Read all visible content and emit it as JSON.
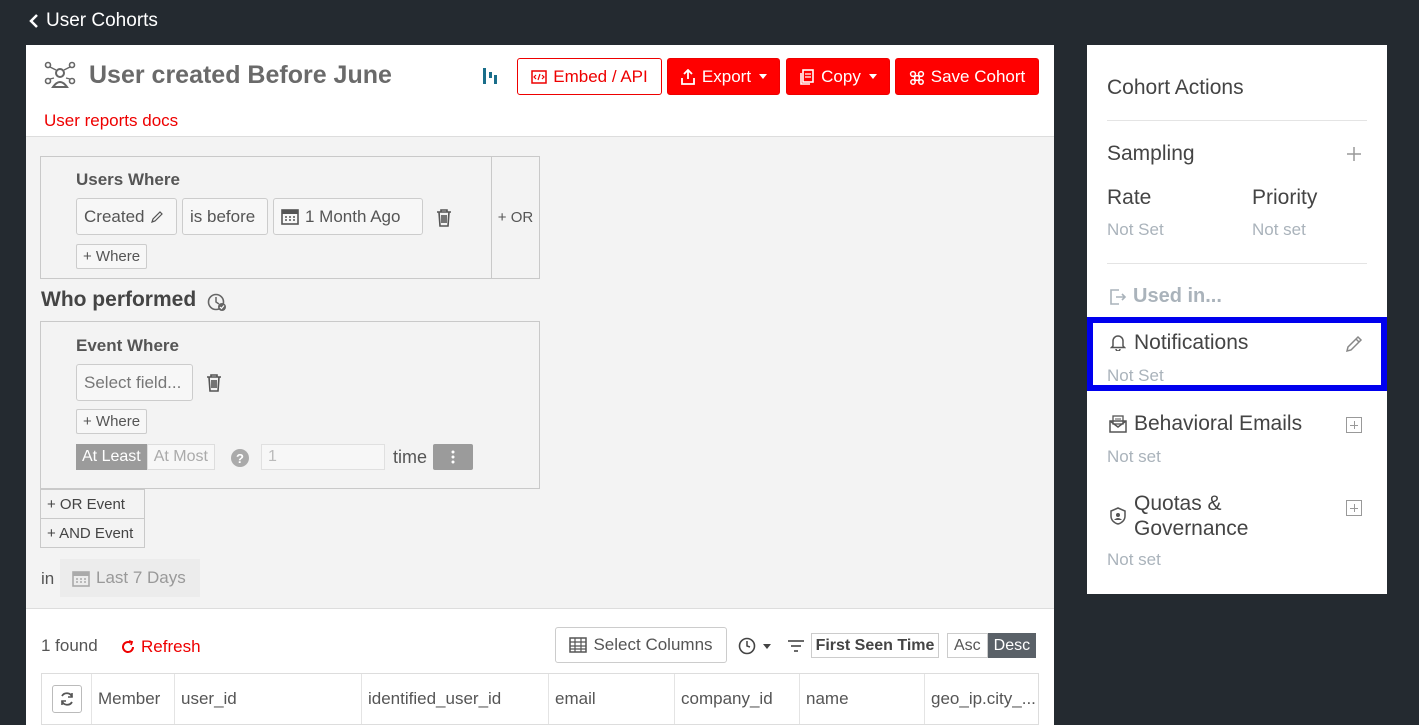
{
  "nav": {
    "back_label": "User Cohorts"
  },
  "header": {
    "title": "User created Before June",
    "docs_link": "User reports docs",
    "buttons": {
      "embed": "Embed / API",
      "export": "Export",
      "copy": "Copy",
      "save": "Save Cohort"
    }
  },
  "users_where": {
    "label": "Users Where",
    "field": "Created",
    "operator": "is before",
    "value": "1 Month Ago",
    "add_where": "+ Where",
    "or": "+ OR"
  },
  "who_performed": {
    "title": "Who performed",
    "event_label": "Event Where",
    "field_placeholder": "Select field...",
    "add_where": "+ Where",
    "at_least": "At Least",
    "at_most": "At Most",
    "count_value": "1",
    "time_label": "time",
    "or_event": "+ OR Event",
    "and_event": "+ AND Event",
    "in_label": "in",
    "range": "Last 7 Days"
  },
  "results": {
    "found": "1 found",
    "refresh": "Refresh",
    "select_columns": "Select Columns",
    "sort_field": "First Seen Time",
    "asc": "Asc",
    "desc": "Desc",
    "columns": [
      "Member",
      "user_id",
      "identified_user_id",
      "email",
      "company_id",
      "name",
      "geo_ip.city_..."
    ]
  },
  "side_panel": {
    "title": "Cohort Actions",
    "sampling": "Sampling",
    "rate_label": "Rate",
    "rate_value": "Not Set",
    "priority_label": "Priority",
    "priority_value": "Not set",
    "used_in": "Used in...",
    "notifications": "Notifications",
    "notifications_value": "Not Set",
    "behavioral_emails": "Behavioral Emails",
    "behavioral_value": "Not set",
    "quotas_line1": "Quotas &",
    "quotas_line2": "Governance",
    "quotas_value": "Not set"
  },
  "colors": {
    "accent_red": "#ff0000",
    "highlight_blue": "#0000ee",
    "background": "#242a30"
  }
}
